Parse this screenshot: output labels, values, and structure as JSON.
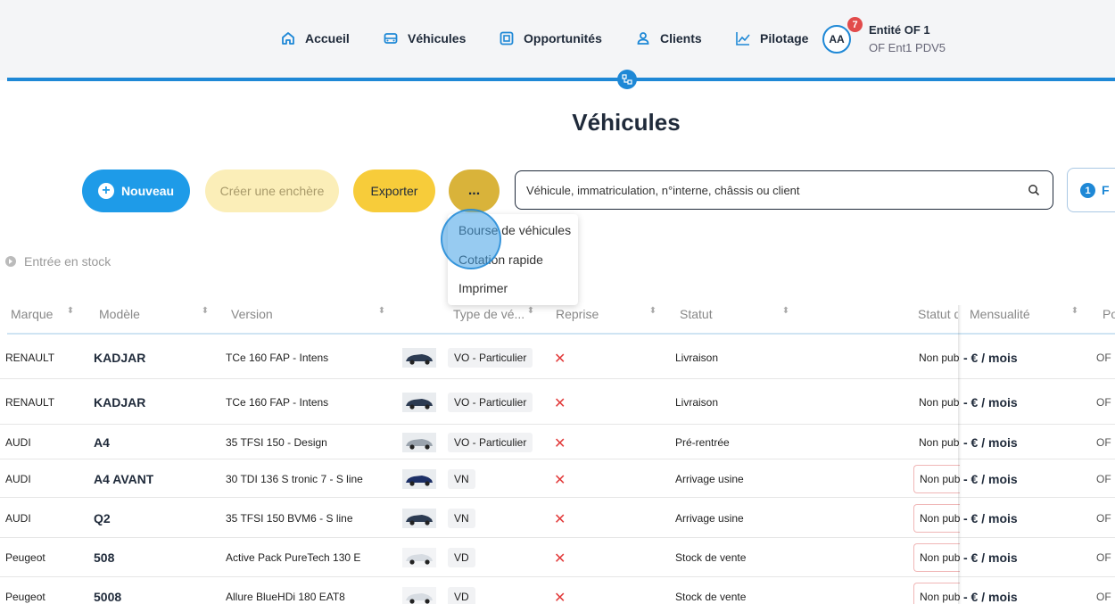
{
  "nav": {
    "items": [
      {
        "label": "Accueil",
        "icon": "home-icon"
      },
      {
        "label": "Véhicules",
        "icon": "car-icon"
      },
      {
        "label": "Opportunités",
        "icon": "opportunity-icon"
      },
      {
        "label": "Clients",
        "icon": "user-icon"
      },
      {
        "label": "Pilotage",
        "icon": "chart-line-icon"
      }
    ],
    "avatar_initials": "AA",
    "notification_count": "7",
    "entity_name": "Entité OF 1",
    "entity_sub": "OF Ent1 PDV5"
  },
  "page": {
    "title": "Véhicules"
  },
  "toolbar": {
    "new_label": "Nouveau",
    "auction_label": "Créer une enchère",
    "export_label": "Exporter",
    "more_label": "...",
    "search_placeholder": "Véhicule, immatriculation, n°interne, châssis ou client",
    "filter_count": "1",
    "filter_label": "F"
  },
  "menu": {
    "items": [
      "Bourse de véhicules",
      "Cotation rapide",
      "Imprimer"
    ]
  },
  "stock_entry": "Entrée en stock",
  "table": {
    "headers": {
      "brand": "Marque",
      "model": "Modèle",
      "version": "Version",
      "type": "Type de vé...",
      "reprise": "Reprise",
      "statut": "Statut",
      "statut_pub": "Statut d",
      "mensualite": "Mensualité",
      "point_vente": "Po"
    },
    "rows": [
      {
        "brand": "RENAULT",
        "model": "KADJAR",
        "version": "TCe 160 FAP - Intens",
        "type": "VO - Particulier",
        "reprise": "✕",
        "statut": "Livraison",
        "pub": "Non publié",
        "price": "- € / mois",
        "pv": "OF"
      },
      {
        "brand": "RENAULT",
        "model": "KADJAR",
        "version": "TCe 160 FAP - Intens",
        "type": "VO - Particulier",
        "reprise": "✕",
        "statut": "Livraison",
        "pub": "Non publié",
        "price": "- € / mois",
        "pv": "OF"
      },
      {
        "brand": "AUDI",
        "model": "A4",
        "version": "35 TFSI 150 - Design",
        "type": "VO - Particulier",
        "reprise": "✕",
        "statut": "Pré-rentrée",
        "pub": "Non publié",
        "price": "- € / mois",
        "pv": "OF"
      },
      {
        "brand": "AUDI",
        "model": "A4 AVANT",
        "version": "30 TDI 136 S tronic 7 - S line",
        "type": "VN",
        "reprise": "✕",
        "statut": "Arrivage usine",
        "pub": "Non publié",
        "price": "- € / mois",
        "pv": "OF"
      },
      {
        "brand": "AUDI",
        "model": "Q2",
        "version": "35 TFSI 150 BVM6 - S line",
        "type": "VN",
        "reprise": "✕",
        "statut": "Arrivage usine",
        "pub": "Non publié",
        "price": "- € / mois",
        "pv": "OF"
      },
      {
        "brand": "Peugeot",
        "model": "508",
        "version": "Active Pack PureTech 130 E",
        "type": "VD",
        "reprise": "✕",
        "statut": "Stock de vente",
        "pub": "Non publié",
        "price": "- € / mois",
        "pv": "OF"
      },
      {
        "brand": "Peugeot",
        "model": "5008",
        "version": "Allure BlueHDi 180 EAT8",
        "type": "VD",
        "reprise": "✕",
        "statut": "Stock de vente",
        "pub": "Non publié",
        "price": "- € / mois",
        "pv": "OF"
      }
    ]
  },
  "colors": {
    "primary": "#1e88d6",
    "accent_yellow": "#f7cc3a",
    "danger": "#e23b3b"
  }
}
